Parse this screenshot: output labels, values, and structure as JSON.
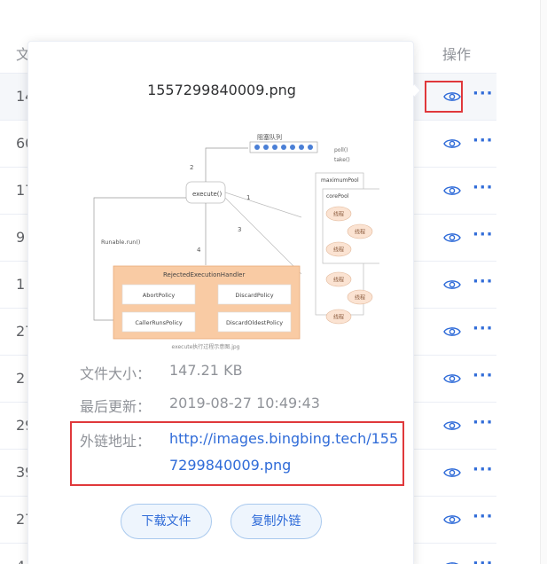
{
  "table": {
    "header_name": "文",
    "header_ops": "操作",
    "rows": [
      {
        "name_fragment": "14"
      },
      {
        "name_fragment": "60"
      },
      {
        "name_fragment": "17"
      },
      {
        "name_fragment": "9"
      },
      {
        "name_fragment": "1"
      },
      {
        "name_fragment": "27"
      },
      {
        "name_fragment": "2"
      },
      {
        "name_fragment": "29"
      },
      {
        "name_fragment": "39"
      },
      {
        "name_fragment": "27"
      },
      {
        "name_fragment": "4"
      }
    ],
    "more_label": "···",
    "eye_icon": "eye-icon"
  },
  "popover": {
    "title": "1557299840009.png",
    "size_label": "文件大小：",
    "size_value": "147.21 KB",
    "updated_label": "最后更新：",
    "updated_value": "2019-08-27 10:49:43",
    "link_label": "外链地址：",
    "link_value": "http://images.bingbing.tech/1557299840009.png",
    "download_label": "下载文件",
    "copy_label": "复制外链"
  },
  "preview_diagram": {
    "queue_label": "阻塞队列",
    "poll_label": "poll()",
    "take_label": "take()",
    "execute_label": "execute()",
    "arrow_labels": [
      "1",
      "2",
      "3",
      "4"
    ],
    "runnable_label": "Runable.run()",
    "max_pool_label": "maximumPool",
    "core_pool_label": "corePool",
    "thread_label": "线程",
    "handler_title": "RejectedExecutionHandler",
    "policies": [
      "AbortPolicy",
      "DiscardPolicy",
      "CallerRunsPolicy",
      "DiscardOldestPolicy"
    ],
    "caption": "execute执行过程示意图.jpg",
    "colors": {
      "handler_fill": "#f9cba4",
      "queue_dot": "#4a7fd6",
      "thread_fill": "#fbe3d2"
    }
  },
  "colors": {
    "accent": "#2f6bd8",
    "highlight_border": "#e0383b"
  }
}
